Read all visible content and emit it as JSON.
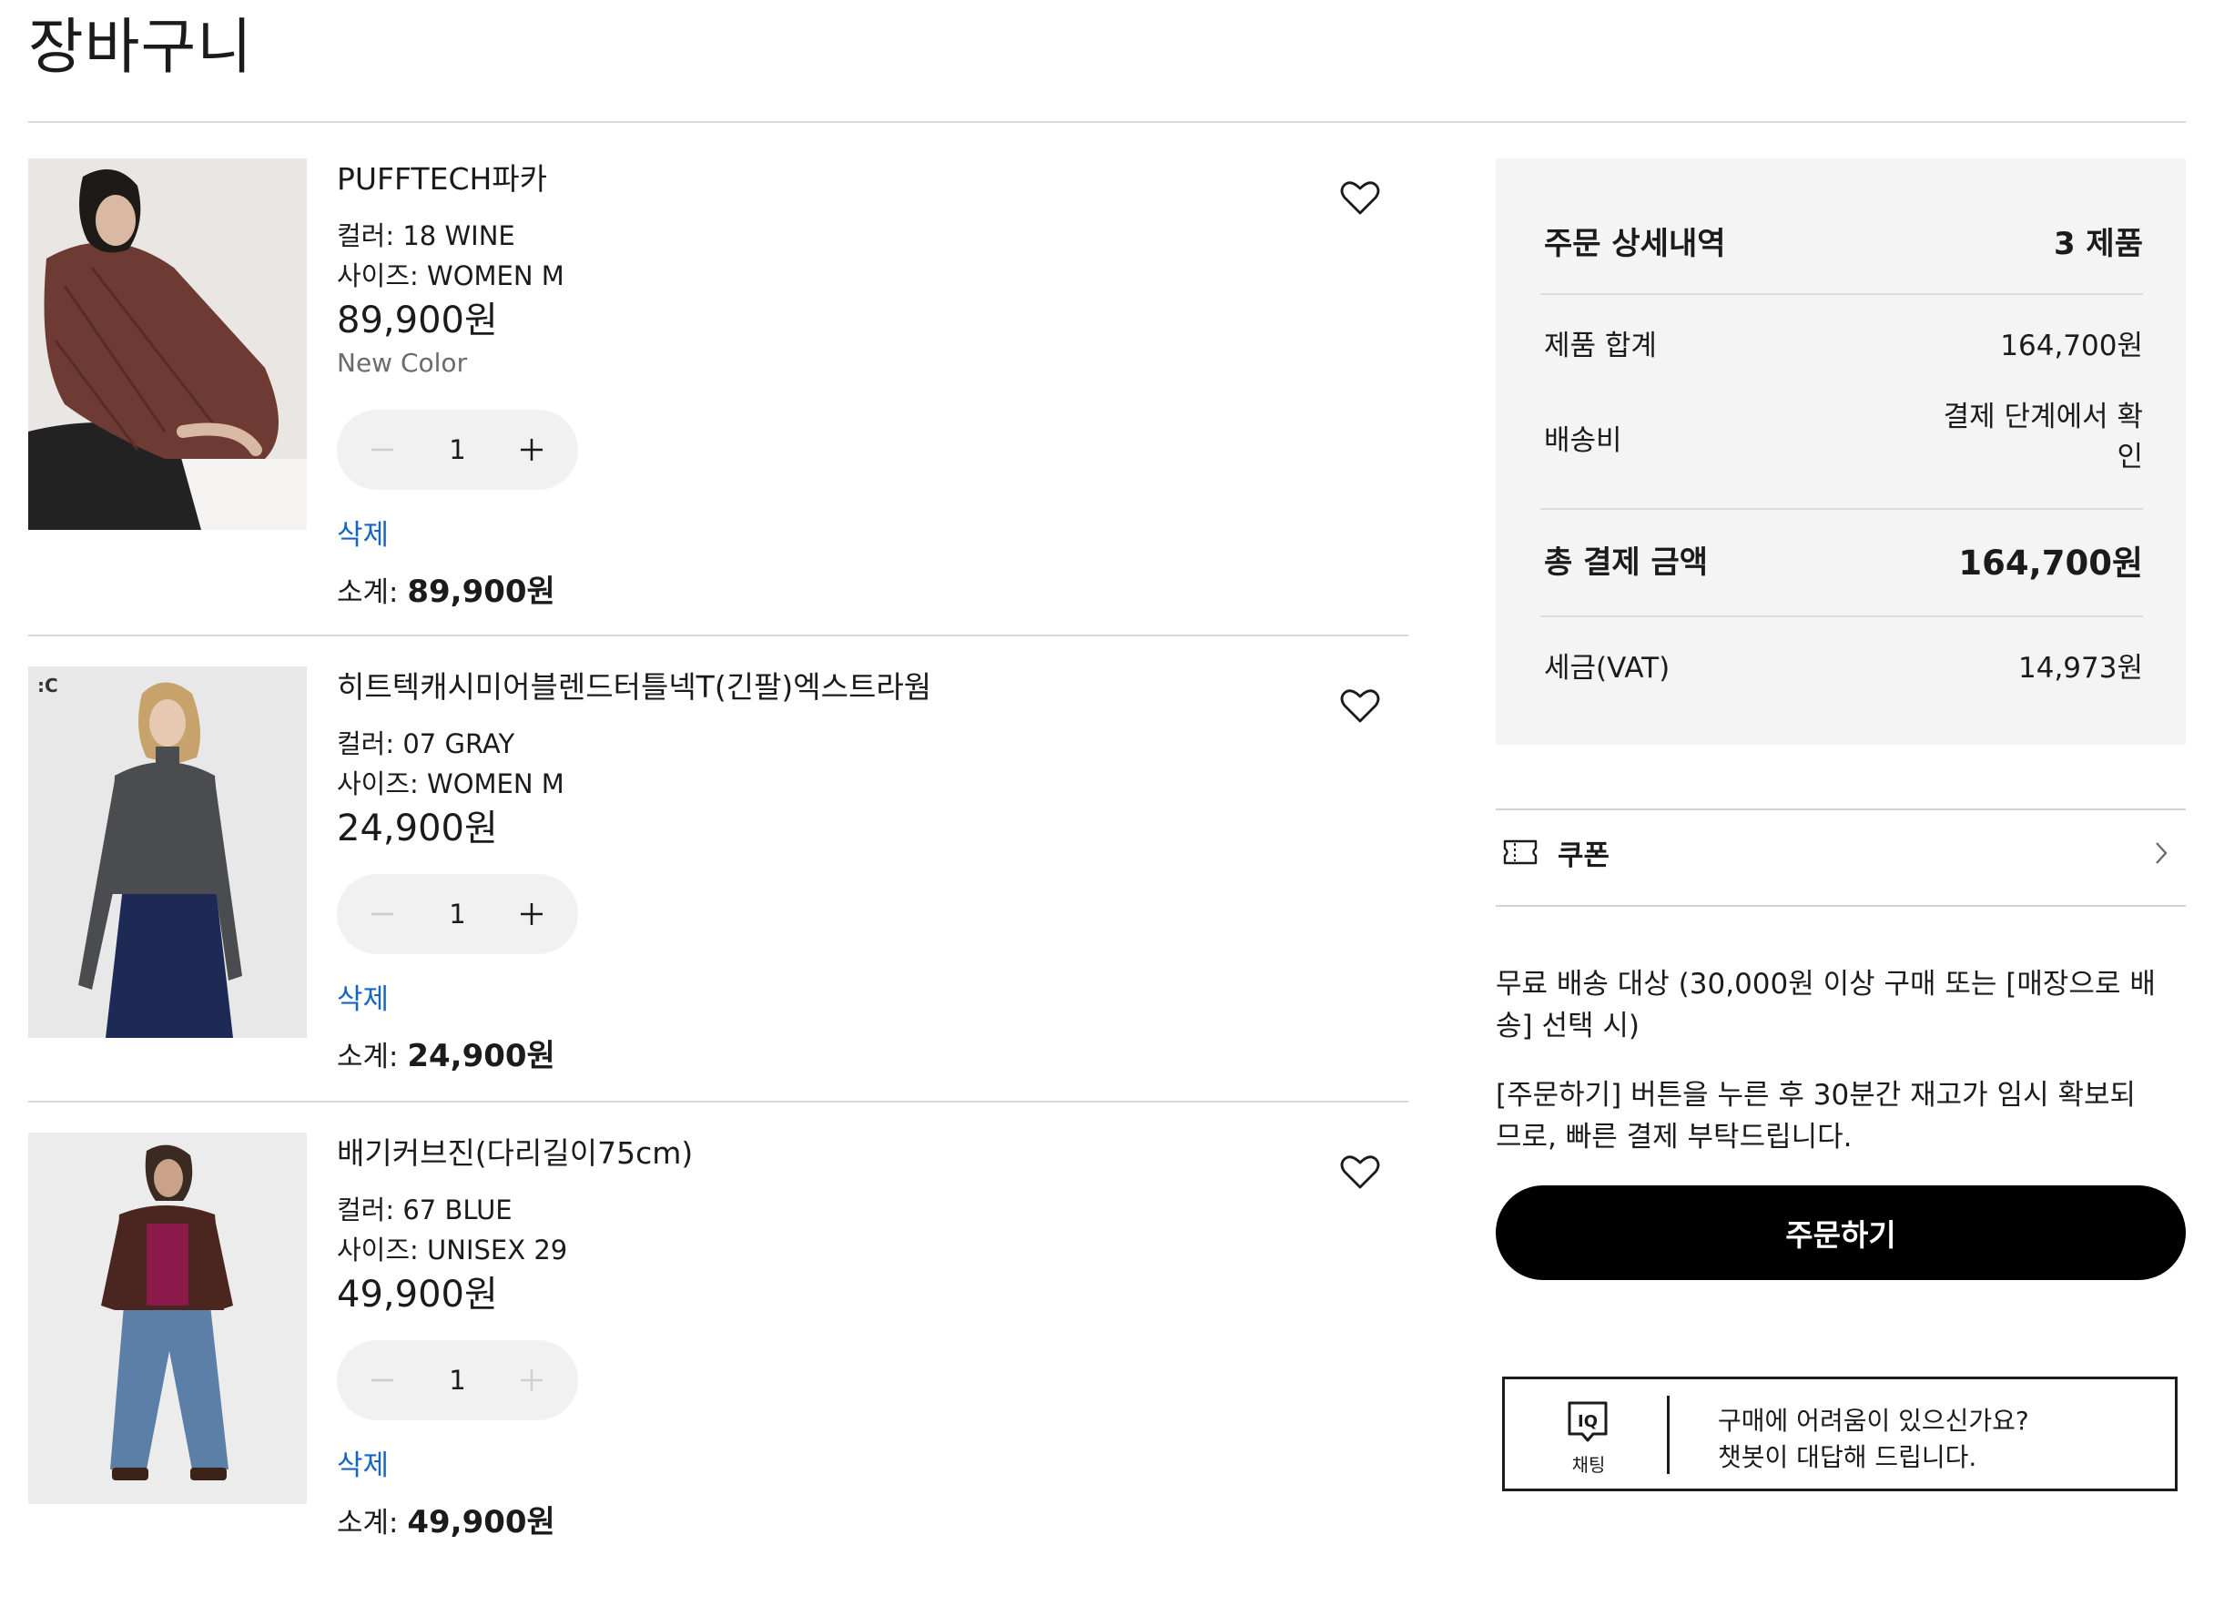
{
  "page": {
    "title": "장바구니"
  },
  "items": [
    {
      "name": "PUFFTECH파카",
      "color": "컬러: 18 WINE",
      "size": "사이즈: WOMEN M",
      "price": "89,900원",
      "tag": "New Color",
      "quantity": "1",
      "delete_label": "삭제",
      "subtotal_label": "소계: ",
      "subtotal_value": "89,900원",
      "plus_enabled": true
    },
    {
      "name": "히트텍캐시미어블렌드터틀넥T(긴팔)엑스트라웜",
      "color": "컬러: 07 GRAY",
      "size": "사이즈: WOMEN M",
      "price": "24,900원",
      "image_badge": ":C",
      "quantity": "1",
      "delete_label": "삭제",
      "subtotal_label": "소계: ",
      "subtotal_value": "24,900원",
      "plus_enabled": true
    },
    {
      "name": "배기커브진(다리길이75cm)",
      "color": "컬러: 67 BLUE",
      "size": "사이즈: UNISEX 29",
      "price": "49,900원",
      "quantity": "1",
      "delete_label": "삭제",
      "subtotal_label": "소계: ",
      "subtotal_value": "49,900원",
      "plus_enabled": false
    }
  ],
  "summary": {
    "heading": "주문 상세내역",
    "count": "3 제품",
    "product_total_label": "제품 합계",
    "product_total_value": "164,700원",
    "shipping_label": "배송비",
    "shipping_value_line1": "결제 단계에서 확",
    "shipping_value_line2": "인",
    "grand_total_label": "총 결제 금액",
    "grand_total_value": "164,700원",
    "vat_label": "세금(VAT)",
    "vat_value": "14,973원"
  },
  "coupon": {
    "label": "쿠폰"
  },
  "notes": {
    "free_shipping_line1": "무료 배송 대상 (30,000원 이상 구매 또는 [매장으로 배",
    "free_shipping_line2": "송] 선택 시)",
    "hold_line1": "[주문하기] 버튼을 누른 후 30분간 재고가 임시 확보되",
    "hold_line2": "므로, 빠른 결제 부탁드립니다."
  },
  "order_button": {
    "label": "주문하기"
  },
  "chat": {
    "icon_text": "IQ",
    "label": "채팅",
    "line1": "구매에 어려움이 있으신가요?",
    "line2": "챗봇이 대답해 드립니다."
  },
  "colors": {
    "link": "#1664c0",
    "summary_bg": "#f4f4f4",
    "button_bg": "#000000",
    "stepper_bg": "#f1f1f1"
  },
  "icons": [
    "heart-icon",
    "minus-icon",
    "plus-icon",
    "coupon-icon",
    "chevron-right-icon",
    "iq-chat-icon"
  ]
}
